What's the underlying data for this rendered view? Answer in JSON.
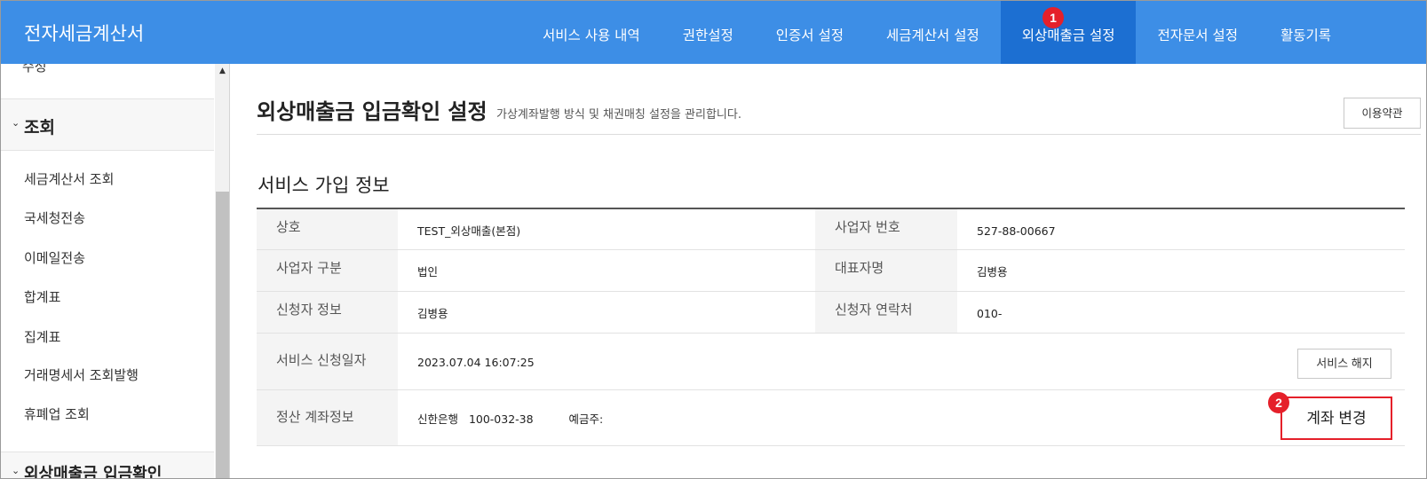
{
  "app": {
    "title": "전자세금계산서"
  },
  "nav": {
    "items": [
      {
        "label": "서비스 사용 내역",
        "active": false
      },
      {
        "label": "권한설정",
        "active": false
      },
      {
        "label": "인증서 설정",
        "active": false
      },
      {
        "label": "세금계산서 설정",
        "active": false
      },
      {
        "label": "외상매출금 설정",
        "active": true
      },
      {
        "label": "전자문서 설정",
        "active": false
      },
      {
        "label": "활동기록",
        "active": false
      }
    ]
  },
  "markers": {
    "first": "1",
    "second": "2"
  },
  "sidebar": {
    "prev_item": "수정",
    "section": "조회",
    "items": [
      "세금계산서 조회",
      "국세청전송",
      "이메일전송",
      "합계표",
      "집계표",
      "거래명세서 조회발행",
      "휴폐업 조회"
    ],
    "next_section": "외상매출금 입금확인"
  },
  "main": {
    "title": "외상매출금 입금확인 설정",
    "description": "가상계좌발행 방식 및 채권매칭 설정을 관리합니다.",
    "terms_button": "이용약관",
    "section_title": "서비스 가입 정보",
    "rows": {
      "company_label": "상호",
      "company_value": "TEST_외상매출(본점)",
      "bizno_label": "사업자 번호",
      "bizno_value": "527-88-00667",
      "biztype_label": "사업자 구분",
      "biztype_value": "법인",
      "ceo_label": "대표자명",
      "ceo_value": "김병용",
      "applicant_label": "신청자 정보",
      "applicant_value": "김병용",
      "contact_label": "신청자 연락처",
      "contact_value": "010-",
      "date_label": "서비스 신청일자",
      "date_value": "2023.07.04 16:07:25",
      "cancel_button": "서비스 해지",
      "account_label": "정산 계좌정보",
      "account_bank": "신한은행",
      "account_number": "100-032-38",
      "account_holder": "예금주:",
      "change_button": "계좌 변경"
    }
  },
  "colors": {
    "nav_bg": "#3d8ee6",
    "nav_active_bg": "#1c6fd2",
    "marker": "#e5202a",
    "highlight_border": "#e5202a"
  }
}
